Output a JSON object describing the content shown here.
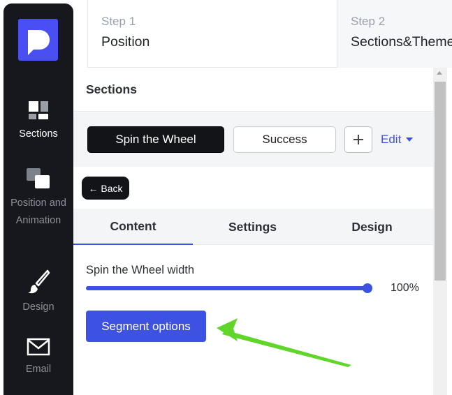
{
  "steps": [
    {
      "number": "Step 1",
      "name": "Position"
    },
    {
      "number": "Step 2",
      "name": "Sections&Theme"
    }
  ],
  "sidebar": {
    "logo": "pisano-logo",
    "items": [
      {
        "label": "Sections",
        "icon": "sections-icon",
        "active": true
      },
      {
        "label": "Position and Animation",
        "icon": "position-animation-icon",
        "active": false
      },
      {
        "label": "Design",
        "icon": "paintbrush-icon",
        "active": false
      },
      {
        "label": "Email",
        "icon": "envelope-icon",
        "active": false
      }
    ]
  },
  "panel": {
    "title": "Sections",
    "section_buttons": [
      "Spin the Wheel",
      "Success"
    ],
    "add_button": "+",
    "edit_label": "Edit",
    "back_label": "← Back",
    "tabs": [
      "Content",
      "Settings",
      "Design"
    ],
    "slider": {
      "label": "Spin the Wheel width",
      "value": 100,
      "value_text": "100%"
    },
    "segment_button": "Segment options"
  },
  "colors": {
    "accent": "#3d52e3",
    "sidebar": "#16181d",
    "annotation": "#5fd629"
  }
}
